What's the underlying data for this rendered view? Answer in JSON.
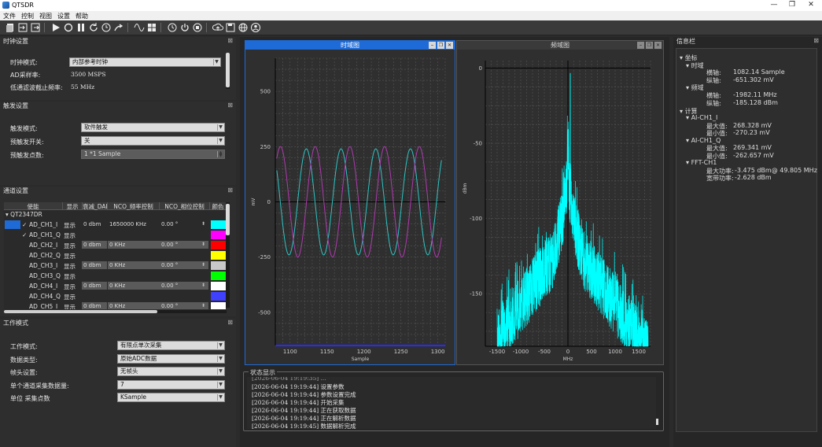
{
  "window": {
    "title": "QTSDR",
    "min": "—",
    "max": "❐",
    "close": "✕"
  },
  "menu": [
    "文件",
    "控制",
    "视图",
    "设置",
    "帮助"
  ],
  "clock_panel": {
    "title": "时钟设置",
    "rows": [
      {
        "label": "时钟模式:",
        "value": "内部参考时钟",
        "kind": "combo"
      },
      {
        "label": "AD采样率:",
        "value": "3500 MSPS",
        "kind": "text"
      },
      {
        "label": "低通滤波截止频率:",
        "value": "55 MHz",
        "kind": "text"
      }
    ]
  },
  "trigger_panel": {
    "title": "触发设置",
    "rows": [
      {
        "label": "触发模式:",
        "value": "软件触发"
      },
      {
        "label": "预触发开关:",
        "value": "关"
      },
      {
        "label": "预触发点数:",
        "value": "1 *1 Sample"
      }
    ]
  },
  "channel_panel": {
    "title": "通道设置",
    "headers": [
      "使能",
      "显示",
      "衰减_DAI",
      "NCO_频率控制",
      "NCO_相位控制",
      "颜色"
    ],
    "device": "QT2347DR",
    "rows": [
      {
        "name": "AD_CH1_I",
        "checked": true,
        "show": "显示",
        "atten": "0 dbm",
        "freq": "1650000 KHz",
        "phase": "0.00 °",
        "color": "#00ffff",
        "enabled": true,
        "selected": true
      },
      {
        "name": "AD_CH1_Q",
        "checked": true,
        "show": "显示",
        "atten": "",
        "freq": "",
        "phase": "",
        "color": "#ff00ff",
        "enabled": true,
        "selected": false
      },
      {
        "name": "AD_CH2_I",
        "checked": false,
        "show": "显示",
        "atten": "0 dbm",
        "freq": "0 KHz",
        "phase": "0.00 °",
        "color": "#ff0000",
        "enabled": false,
        "selected": false
      },
      {
        "name": "AD_CH2_Q",
        "checked": false,
        "show": "显示",
        "atten": "",
        "freq": "",
        "phase": "",
        "color": "#ffff00",
        "enabled": false,
        "selected": false
      },
      {
        "name": "AD_CH3_I",
        "checked": false,
        "show": "显示",
        "atten": "0 dbm",
        "freq": "0 KHz",
        "phase": "0.00 °",
        "color": "#c8c8c8",
        "enabled": false,
        "selected": false
      },
      {
        "name": "AD_CH3_Q",
        "checked": false,
        "show": "显示",
        "atten": "",
        "freq": "",
        "phase": "",
        "color": "#00ff00",
        "enabled": false,
        "selected": false
      },
      {
        "name": "AD_CH4_I",
        "checked": false,
        "show": "显示",
        "atten": "0 dbm",
        "freq": "0 KHz",
        "phase": "0.00 °",
        "color": "#ffffff",
        "enabled": false,
        "selected": false
      },
      {
        "name": "AD_CH4_Q",
        "checked": false,
        "show": "显示",
        "atten": "",
        "freq": "",
        "phase": "",
        "color": "#4040ff",
        "enabled": false,
        "selected": false
      },
      {
        "name": "AD_CH5_I",
        "checked": false,
        "show": "显示",
        "atten": "0 dbm",
        "freq": "0 KHz",
        "phase": "0.00 °",
        "color": "#ffffff",
        "enabled": false,
        "selected": false
      }
    ]
  },
  "work_panel": {
    "title": "工作模式",
    "rows": [
      {
        "label": "工作模式:",
        "value": "有限点单次采集",
        "kind": "combo"
      },
      {
        "label": "数据类型:",
        "value": "原始ADC数据",
        "kind": "combo"
      },
      {
        "label": "帧头设置:",
        "value": "无帧头",
        "kind": "combo"
      },
      {
        "label": "单个通道采集数据量:",
        "value": "7",
        "kind": "combo"
      },
      {
        "label": "单位 采集点数",
        "value": "KSample",
        "kind": "combo"
      }
    ]
  },
  "time_chart": {
    "tab_title": "时域图",
    "btn_min": "–",
    "btn_restore": "❐",
    "btn_close": "✕"
  },
  "freq_chart": {
    "tab_title": "频域图",
    "btn_min": "–",
    "btn_restore": "❐",
    "btn_close": "✕"
  },
  "chart_data": [
    {
      "type": "line",
      "xlabel": "Sample",
      "ylabel": "mV",
      "xlim": [
        1080,
        1310
      ],
      "ylim": [
        -650,
        650
      ],
      "xticks": [
        1100,
        1150,
        1200,
        1250,
        1300
      ],
      "yticks": [
        -500,
        -250,
        0,
        250,
        500
      ],
      "grid": true,
      "series": [
        {
          "color": "#2ec4c4",
          "amplitude": 240,
          "period_samples": 47,
          "peak_at": 1122,
          "x_range": [
            1082,
            1305
          ]
        },
        {
          "color": "#b03ab0",
          "amplitude": 250,
          "period_samples": 47,
          "peak_at": 1134,
          "x_range": [
            1082,
            1305
          ]
        }
      ]
    },
    {
      "type": "line",
      "xlabel": "MHz",
      "ylabel": "dBm",
      "xlim": [
        -1750,
        1750
      ],
      "ylim": [
        -185,
        5
      ],
      "xticks": [
        -1500,
        -1000,
        -500,
        0,
        500,
        1000,
        1500
      ],
      "yticks": [
        -150,
        -100,
        -50,
        0
      ],
      "grid": true,
      "series": [
        {
          "color": "#00ffff",
          "peak_freq": 49.805,
          "peak_power": -3.475,
          "floor": -185
        }
      ]
    }
  ],
  "info_panel": {
    "title": "信息栏",
    "coord": "坐标",
    "time_domain": "时域",
    "x_label": "横轴:",
    "y_label": "纵轴:",
    "time_x": "1082.14 Sample",
    "time_y": "-651.302 mV",
    "freq_domain": "频域",
    "freq_x": "-1982.11 MHz",
    "freq_y": "-185.128 dBm",
    "calc": "计算",
    "ch_i": "AI-CH1_I",
    "max_label": "最大值:",
    "min_label": "最小值:",
    "ch_i_max": "268.328 mV",
    "ch_i_min": "-270.23 mV",
    "ch_q": "AI-CH1_Q",
    "ch_q_max": "269.341 mV",
    "ch_q_min": "-262.657 mV",
    "fft": "FFT-CH1",
    "max_power_label": "最大功率:",
    "max_power": "-3.475 dBm@ 49.805 MHz",
    "band_power_label": "宽带功率:",
    "band_power": "-2.628 dBm"
  },
  "status_panel": {
    "title": "状态显示",
    "lines": [
      "[2026-06-04 19:19:44] 设置参数",
      "[2026-06-04 19:19:44] 参数设置完成",
      "[2026-06-04 19:19:44] 开始采集",
      "[2026-06-04 19:19:44] 正在获取数据",
      "[2026-06-04 19:19:44] 正在解析数据",
      "[2026-06-04 19:19:45] 数据解析完成"
    ]
  },
  "toolbar_icons": [
    "open-file-icon",
    "import-icon",
    "export-icon",
    "settings-icon",
    "camera-icon",
    "save-icon",
    "play-icon",
    "loop-icon",
    "pause-icon",
    "refresh-icon",
    "clock-settings-icon",
    "share-icon",
    "wave-icon",
    "grid-icon",
    "history-icon",
    "power-icon",
    "stop-icon",
    "upload-icon",
    "disk-icon",
    "globe-icon",
    "user-icon"
  ]
}
